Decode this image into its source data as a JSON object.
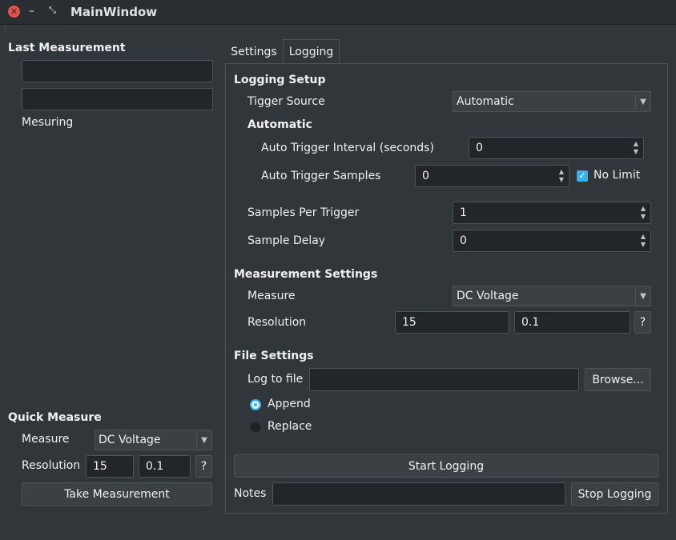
{
  "window": {
    "title": "MainWindow",
    "close_glyph": "✕",
    "minimize_glyph": "–",
    "maximize_glyph": "⤡",
    "grip_glyph": "⁝"
  },
  "left_panel": {
    "last_measurement": {
      "heading": "Last Measurement",
      "value1": "",
      "value2": "",
      "status": "Mesuring"
    },
    "quick_measure": {
      "heading": "Quick Measure",
      "measure_label": "Measure",
      "measure_value": "DC Voltage",
      "resolution_label": "Resolution",
      "resolution_value1": "15",
      "resolution_value2": "0.1",
      "help_label": "?",
      "take_button": "Take Measurement"
    }
  },
  "tabs": [
    {
      "label": "Settings",
      "active": false
    },
    {
      "label": "Logging",
      "active": true
    }
  ],
  "logging": {
    "setup": {
      "heading": "Logging Setup",
      "trigger_source_label": "Tigger Source",
      "trigger_source_value": "Automatic",
      "automatic_heading": "Automatic",
      "interval_label": "Auto Trigger Interval (seconds)",
      "interval_value": "0",
      "samples_label": "Auto Trigger Samples",
      "samples_value": "0",
      "no_limit_label": "No Limit",
      "no_limit_checked": true,
      "samples_per_trigger_label": "Samples Per Trigger",
      "samples_per_trigger_value": "1",
      "sample_delay_label": "Sample Delay",
      "sample_delay_value": "0"
    },
    "measurement": {
      "heading": "Measurement Settings",
      "measure_label": "Measure",
      "measure_value": "DC Voltage",
      "resolution_label": "Resolution",
      "resolution_value1": "15",
      "resolution_value2": "0.1",
      "help_label": "?"
    },
    "file": {
      "heading": "File Settings",
      "log_to_file_label": "Log to file",
      "log_to_file_value": "",
      "browse_button": "Browse...",
      "append_label": "Append",
      "replace_label": "Replace",
      "selected_mode": "Append"
    },
    "start_button": "Start Logging",
    "notes_label": "Notes",
    "notes_value": "",
    "stop_button": "Stop Logging"
  },
  "icons": {
    "combo_arrow": "chevron-down-icon",
    "spin_up": "chevron-up-icon",
    "spin_down": "chevron-down-icon",
    "checkbox_check": "check-icon"
  },
  "colors": {
    "background": "#31363b",
    "field": "#232629",
    "accent": "#3daee9",
    "close_button": "#e2544f"
  }
}
